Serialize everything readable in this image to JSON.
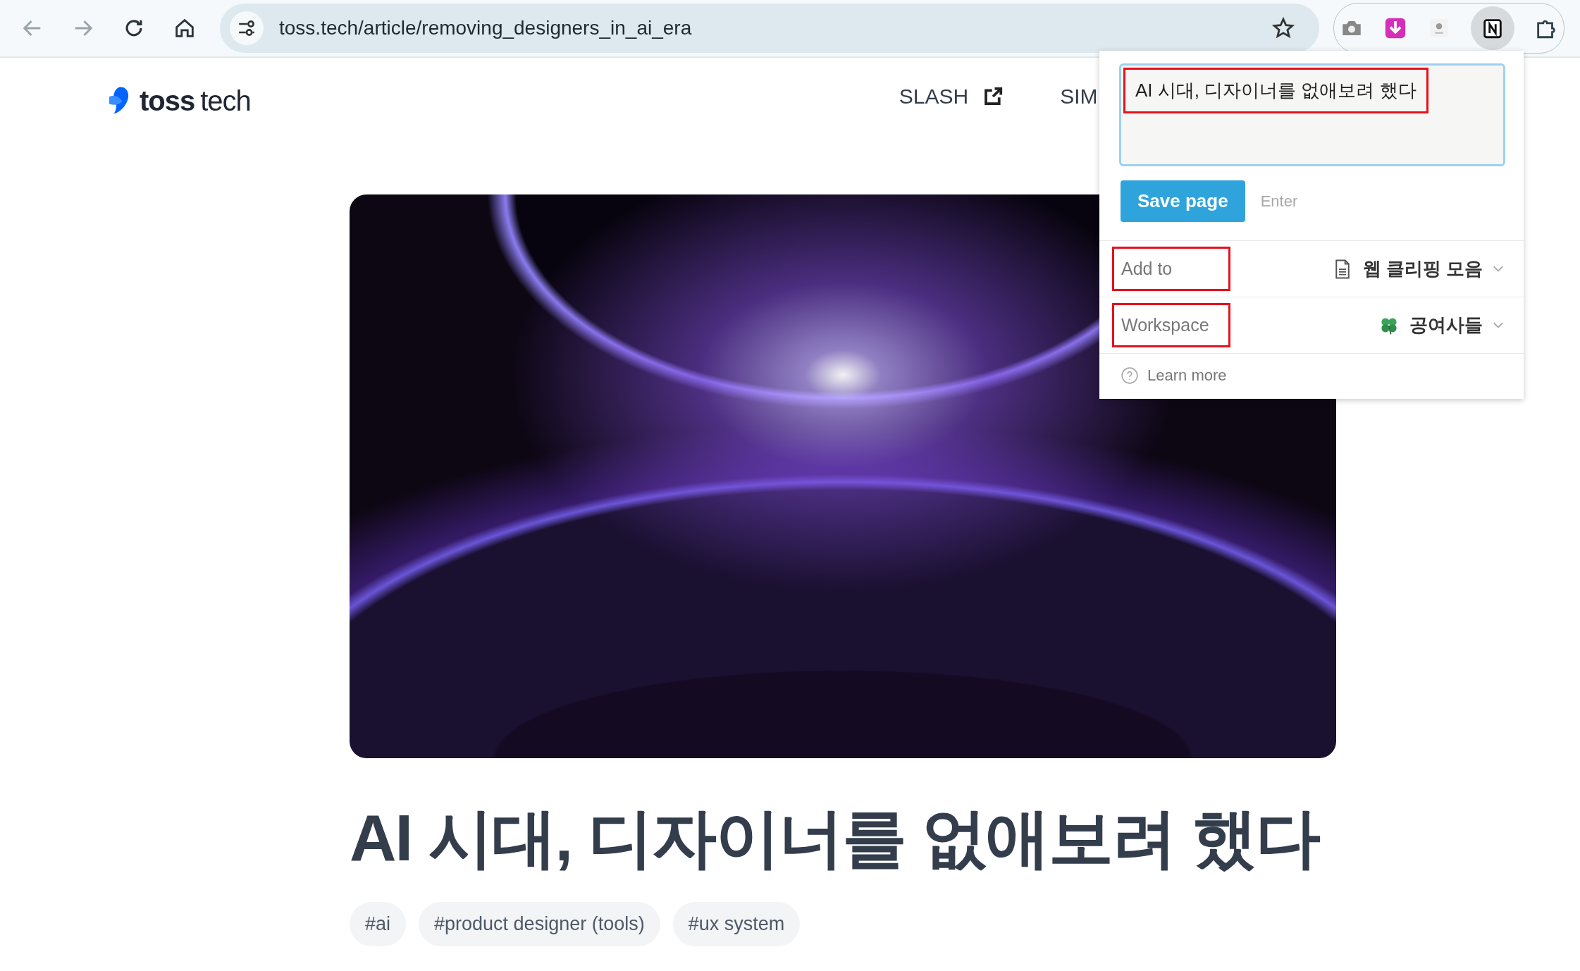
{
  "browser": {
    "url": "toss.tech/article/removing_designers_in_ai_era"
  },
  "site": {
    "logo_bold": "toss",
    "logo_light": "tech",
    "nav": [
      {
        "label": "SLASH",
        "external": true
      },
      {
        "label": "SIM",
        "external": false
      }
    ]
  },
  "article": {
    "title": "AI 시대, 디자이너를 없애보려 했다",
    "tags": [
      "#ai",
      "#product designer (tools)",
      "#ux system"
    ]
  },
  "clipper": {
    "title_value": "AI 시대, 디자이너를 없애보려 했다",
    "save_button": "Save page",
    "shortcut": "Enter",
    "fields": [
      {
        "label": "Add to",
        "value": "웹 클리핑 모음",
        "kind": "page"
      },
      {
        "label": "Workspace",
        "value": "공여사들",
        "kind": "workspace"
      }
    ],
    "help_link": "Learn more"
  }
}
